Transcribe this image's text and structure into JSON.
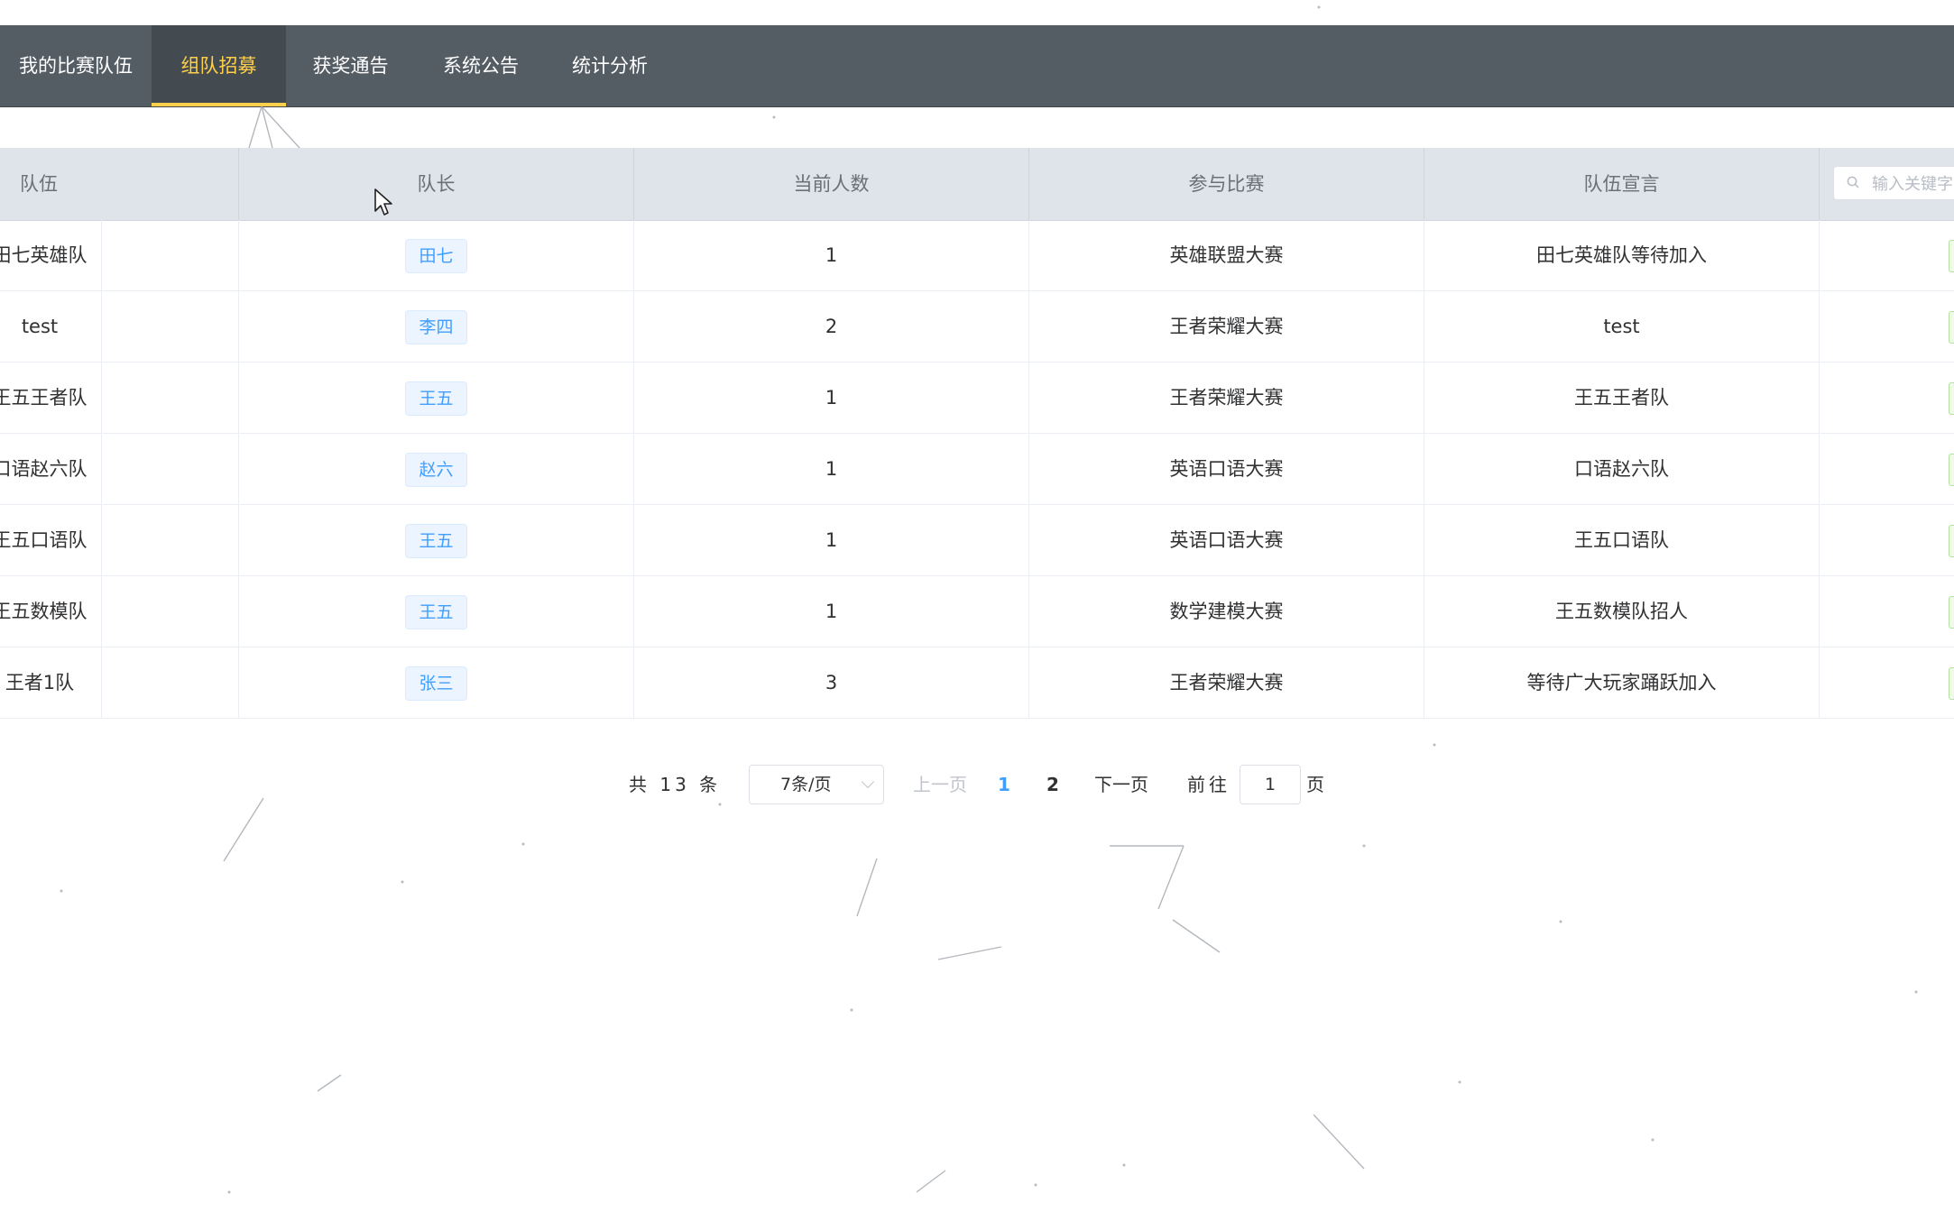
{
  "nav": {
    "items": [
      {
        "label": "我的比赛队伍",
        "active": false
      },
      {
        "label": "组队招募",
        "active": true
      },
      {
        "label": "获奖通告",
        "active": false
      },
      {
        "label": "系统公告",
        "active": false
      },
      {
        "label": "统计分析",
        "active": false
      }
    ],
    "active_color": "#ffd04b",
    "background": "#545c64"
  },
  "table": {
    "columns": [
      "队伍",
      "队长",
      "当前人数",
      "参与比赛",
      "队伍宣言"
    ],
    "search_placeholder": "输入关键字",
    "rows": [
      {
        "team": "田七英雄队",
        "captain": "田七",
        "count": "1",
        "contest": "英雄联盟大赛",
        "slogan": "田七英雄队等待加入"
      },
      {
        "team": "test",
        "captain": "李四",
        "count": "2",
        "contest": "王者荣耀大赛",
        "slogan": "test"
      },
      {
        "team": "王五王者队",
        "captain": "王五",
        "count": "1",
        "contest": "王者荣耀大赛",
        "slogan": "王五王者队"
      },
      {
        "team": "口语赵六队",
        "captain": "赵六",
        "count": "1",
        "contest": "英语口语大赛",
        "slogan": "口语赵六队"
      },
      {
        "team": "王五口语队",
        "captain": "王五",
        "count": "1",
        "contest": "英语口语大赛",
        "slogan": "王五口语队"
      },
      {
        "team": "王五数模队",
        "captain": "王五",
        "count": "1",
        "contest": "数学建模大赛",
        "slogan": "王五数模队招人"
      },
      {
        "team": "王者1队",
        "captain": "张三",
        "count": "3",
        "contest": "王者荣耀大赛",
        "slogan": "等待广大玩家踊跃加入"
      }
    ]
  },
  "pagination": {
    "total_label": "共 13 条",
    "page_size": "7条/页",
    "prev": "上一页",
    "pages": [
      "1",
      "2"
    ],
    "current_page": "1",
    "next": "下一页",
    "goto_label": "前往",
    "goto_value": "1",
    "goto_suffix": "页"
  },
  "colors": {
    "accent": "#409eff",
    "header_bg": "#dfe3ea"
  },
  "icons": [
    "search-icon",
    "chevron-down-icon",
    "mouse-cursor-icon"
  ]
}
